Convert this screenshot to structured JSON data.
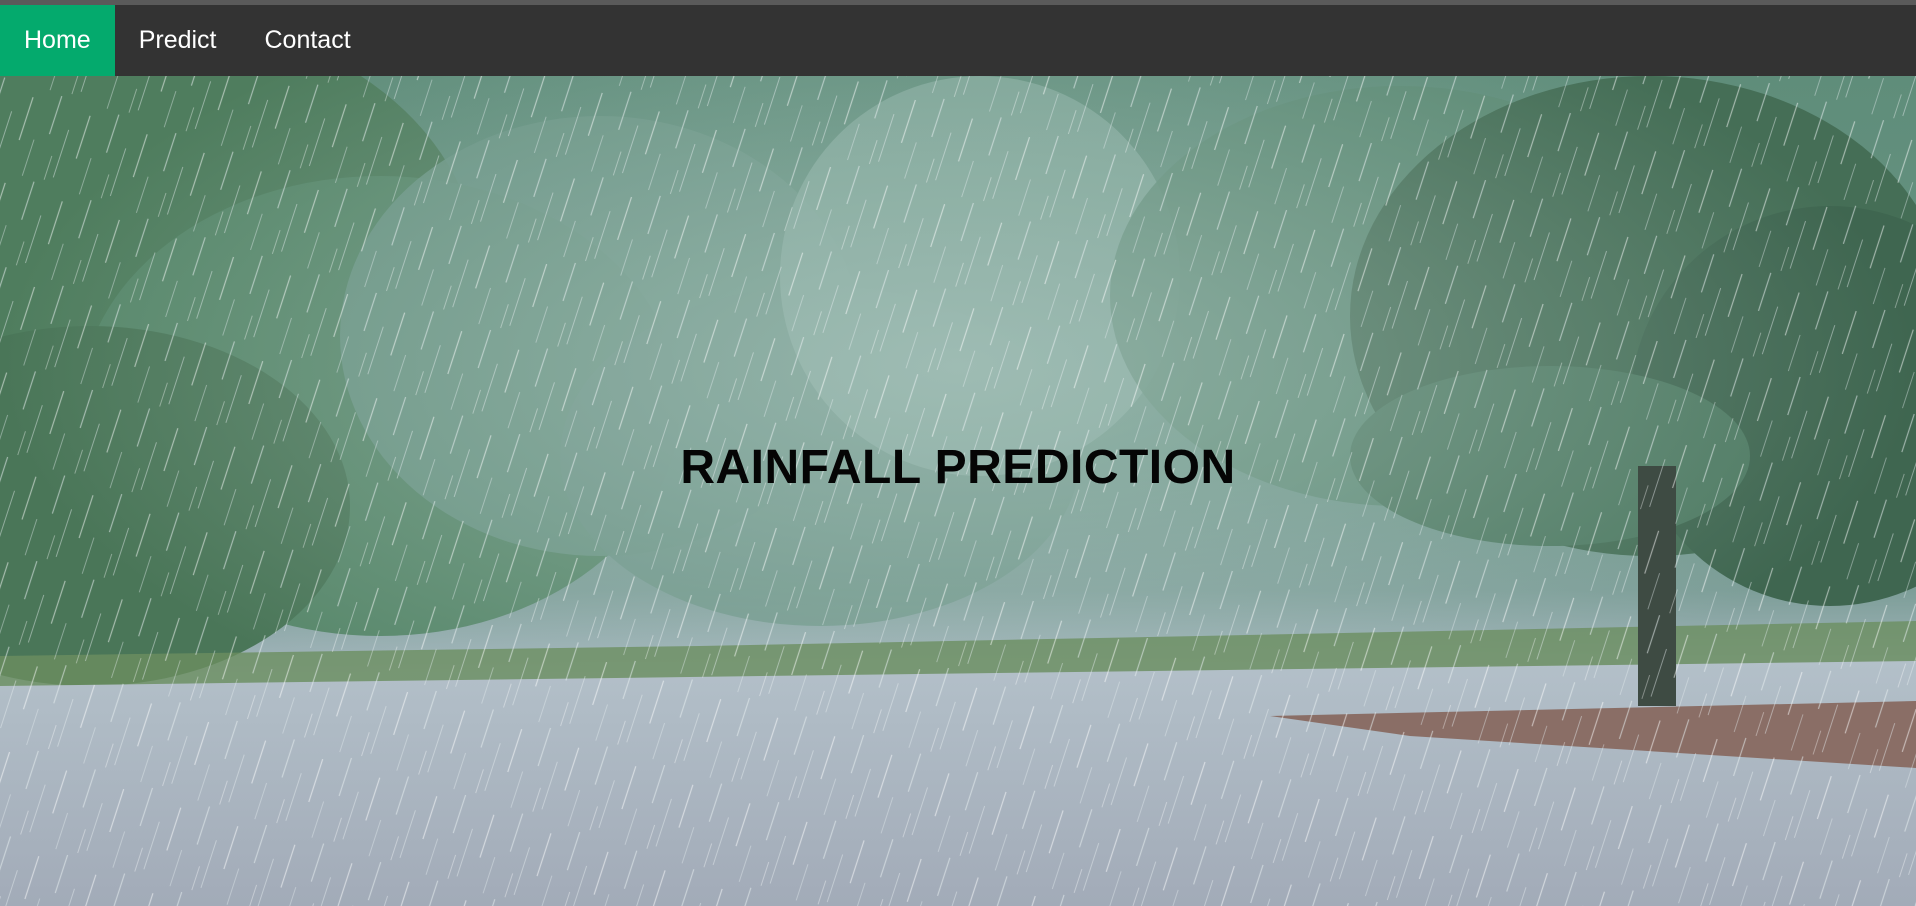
{
  "navbar": {
    "items": [
      {
        "label": "Home",
        "active": true
      },
      {
        "label": "Predict",
        "active": false
      },
      {
        "label": "Contact",
        "active": false
      }
    ],
    "active_color": "#04aa6d",
    "background_color": "#333333"
  },
  "hero": {
    "title": "RAINFALL PREDICTION",
    "background_description_icon": "rainy-park-background-image"
  }
}
